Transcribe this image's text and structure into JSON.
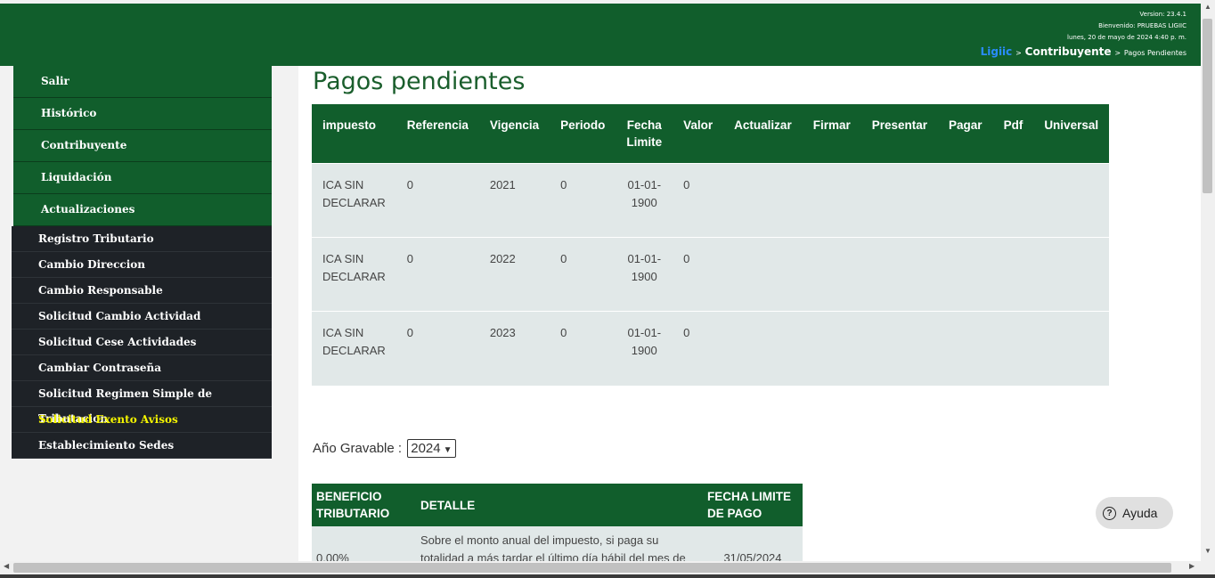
{
  "header": {
    "version": "Version: 23.4.1",
    "welcome": "Bienvenido: PRUEBAS LIGIIC",
    "datetime": "lunes, 20 de mayo de 2024 4:40 p. m.",
    "breadcrumb": {
      "root": "Ligiic",
      "sep": ">",
      "current": "Contribuyente",
      "page": "Pagos Pendientes"
    }
  },
  "menu": {
    "primary": [
      "Salir",
      "Histórico",
      "Contribuyente",
      "Liquidación",
      "Actualizaciones"
    ],
    "sub": [
      "Registro Tributario",
      "Cambio Direccion",
      "Cambio Responsable",
      "Solicitud Cambio Actividad",
      "Solicitud Cese Actividades",
      "Cambiar Contraseña",
      "Solicitud Regimen Simple de Tributacion",
      "Solicitud Exento Avisos",
      "Establecimiento Sedes"
    ],
    "active": "Solicitud Exento Avisos"
  },
  "page": {
    "title": "Pagos pendientes"
  },
  "pending_table": {
    "headers": [
      "impuesto",
      "Referencia",
      "Vigencia",
      "Periodo",
      "Fecha Limite",
      "Valor",
      "Actualizar",
      "Firmar",
      "Presentar",
      "Pagar",
      "Pdf",
      "Universal"
    ],
    "rows": [
      [
        "ICA SIN DECLARAR",
        "0",
        "2021",
        "0",
        "01-01-1900",
        "0"
      ],
      [
        "ICA SIN DECLARAR",
        "0",
        "2022",
        "0",
        "01-01-1900",
        "0"
      ],
      [
        "ICA SIN DECLARAR",
        "0",
        "2023",
        "0",
        "01-01-1900",
        "0"
      ]
    ]
  },
  "year_filter": {
    "label": "Año Gravable :",
    "selected": "2024"
  },
  "benefit_table": {
    "headers": [
      "BENEFICIO TRIBUTARIO",
      "DETALLE",
      "FECHA LIMITE DE PAGO"
    ],
    "rows": [
      [
        "0.00%",
        "Sobre el monto anual del impuesto, si paga su totalidad a más tardar el último día hábil del mes de",
        "31/05/2024"
      ]
    ]
  },
  "help_button": {
    "label": "Ayuda"
  },
  "colors": {
    "brand_green": "#115e2c",
    "row_bg": "#e1e8e8",
    "sidebar_dark": "#1e2227",
    "active_menu": "#f5f500"
  }
}
